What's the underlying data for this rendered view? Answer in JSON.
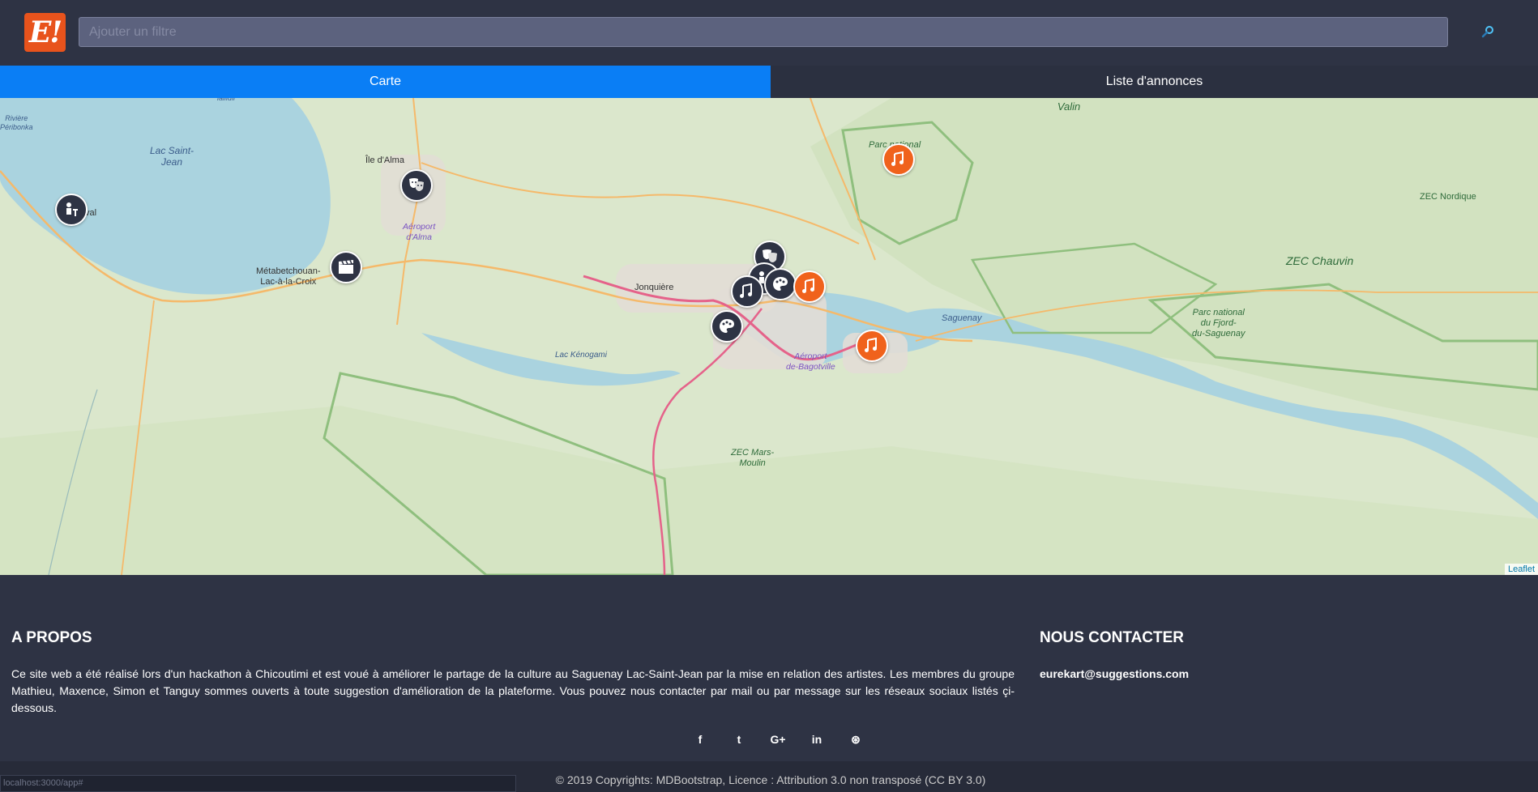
{
  "header": {
    "logo_text": "E!",
    "search_placeholder": "Ajouter un filtre",
    "search_icon": "search-icon"
  },
  "tabs": [
    {
      "label": "Carte",
      "active": true
    },
    {
      "label": "Liste d'annonces",
      "active": false
    }
  ],
  "map": {
    "labels": {
      "lac_saint_jean": "Lac Saint-\nJean",
      "ile_dalma": "Île d'Alma",
      "aeroport_alma": "Aéroport\nd'Alma",
      "metabetchouan": "Métabetchouan-\nLac-à-la-Croix",
      "jonquiere": "Jonquière",
      "lac_kenogami": "Lac Kénogami",
      "aeroport_bagotville": "Aéroport\nde-Bagotville",
      "saguenay_river": "Saguenay",
      "zec_martin_valin": "ZEC Martin-\nValin",
      "parc_monts_valin": "Parc national\nde...",
      "zec_nordique": "ZEC Nordique",
      "zec_chauvin": "ZEC Chauvin",
      "parc_fjord": "Parc national\ndu Fjord-\ndu-Saguenay",
      "zec_mars_moulin": "ZEC Mars-\nMoulin",
      "riviere": "Rivière\nPéribonka",
      "roberval": "val",
      "tail": "lalliuli"
    },
    "markers": [
      {
        "name": "marker-music-monts-valin",
        "type": "music",
        "color": "orange"
      },
      {
        "name": "marker-theatre-alma",
        "type": "theatre",
        "color": "dark"
      },
      {
        "name": "marker-performer-roberval",
        "type": "performer",
        "color": "dark"
      },
      {
        "name": "marker-cinema-metabetchouan",
        "type": "cinema",
        "color": "dark"
      },
      {
        "name": "marker-theatre-chicoutimi",
        "type": "theatre",
        "color": "dark"
      },
      {
        "name": "marker-performer-chicoutimi",
        "type": "performer",
        "color": "dark"
      },
      {
        "name": "marker-music-chicoutimi",
        "type": "music",
        "color": "dark"
      },
      {
        "name": "marker-art-chicoutimi",
        "type": "art",
        "color": "dark"
      },
      {
        "name": "marker-music-chicoutimi-orange",
        "type": "music",
        "color": "orange"
      },
      {
        "name": "marker-art-south",
        "type": "art",
        "color": "dark"
      },
      {
        "name": "marker-music-la-baie",
        "type": "music",
        "color": "orange"
      }
    ],
    "attribution": "Leaflet"
  },
  "footer": {
    "about_title": "A PROPOS",
    "about_text": "Ce site web a été réalisé lors d'un hackathon à Chicoutimi et est voué à améliorer le partage de la culture au Saguenay Lac-Saint-Jean par la mise en relation des artistes. Les membres du groupe Mathieu, Maxence, Simon et Tanguy sommes ouverts à toute suggestion d'amélioration de la plateforme. Vous pouvez nous contacter par mail ou par message sur les réseaux sociaux listés çi-dessous.",
    "contact_title": "NOUS CONTACTER",
    "contact_email": "eurekart@suggestions.com",
    "socials": [
      {
        "name": "facebook",
        "glyph": "f"
      },
      {
        "name": "twitter",
        "glyph": "t"
      },
      {
        "name": "google-plus",
        "glyph": "G+"
      },
      {
        "name": "linkedin",
        "glyph": "in"
      },
      {
        "name": "dribbble",
        "glyph": "⊛"
      }
    ],
    "copyright": "© 2019 Copyrights: MDBootstrap, Licence : Attribution 3.0 non transposé (CC BY 3.0)"
  },
  "status_bar": {
    "url": "localhost:3000/app#"
  },
  "colors": {
    "background": "#2e3344",
    "accent_tab": "#0a7ef5",
    "logo": "#e8531c",
    "marker_orange": "#f0621c",
    "marker_dark": "#2e3344",
    "water": "#aad3df",
    "land": "#d8e5c8"
  }
}
